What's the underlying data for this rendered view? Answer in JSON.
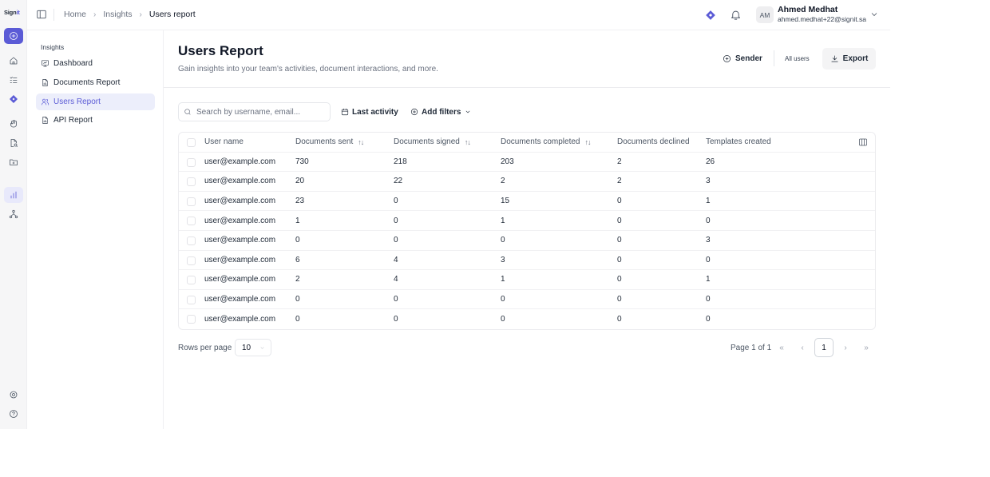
{
  "app": {
    "logo": "Sign",
    "logo_accent": "it"
  },
  "breadcrumb": {
    "home": "Home",
    "section": "Insights",
    "current": "Users report"
  },
  "user": {
    "initials": "AM",
    "name": "Ahmed Medhat",
    "email": "ahmed.medhat+22@signit.sa"
  },
  "sidebar": {
    "heading": "Insights",
    "items": [
      {
        "label": "Dashboard"
      },
      {
        "label": "Documents Report"
      },
      {
        "label": "Users Report"
      },
      {
        "label": "API Report"
      }
    ]
  },
  "page": {
    "title": "Users Report",
    "subtitle": "Gain insights into your team's activities, document interactions, and more.",
    "sender_label": "Sender",
    "all_users_label": "All users",
    "export_label": "Export"
  },
  "toolbar": {
    "search_placeholder": "Search by username, email...",
    "last_activity": "Last activity",
    "add_filters": "Add filters"
  },
  "table": {
    "columns": [
      "User name",
      "Documents sent",
      "Documents signed",
      "Documents completed",
      "Documents declined",
      "Templates created"
    ],
    "rows": [
      [
        "user@example.com",
        "730",
        "218",
        "203",
        "2",
        "26"
      ],
      [
        "user@example.com",
        "20",
        "22",
        "2",
        "2",
        "3"
      ],
      [
        "user@example.com",
        "23",
        "0",
        "15",
        "0",
        "1"
      ],
      [
        "user@example.com",
        "1",
        "0",
        "1",
        "0",
        "0"
      ],
      [
        "user@example.com",
        "0",
        "0",
        "0",
        "0",
        "3"
      ],
      [
        "user@example.com",
        "6",
        "4",
        "3",
        "0",
        "0"
      ],
      [
        "user@example.com",
        "2",
        "4",
        "1",
        "0",
        "1"
      ],
      [
        "user@example.com",
        "0",
        "0",
        "0",
        "0",
        "0"
      ],
      [
        "user@example.com",
        "0",
        "0",
        "0",
        "0",
        "0"
      ]
    ]
  },
  "pagination": {
    "rows_per_page_label": "Rows per page",
    "rows_per_page": "10",
    "page_info": "Page 1 of 1",
    "current_page": "1"
  },
  "colors": {
    "accent": "#5b5bd6",
    "active_bg": "#eceefb"
  }
}
